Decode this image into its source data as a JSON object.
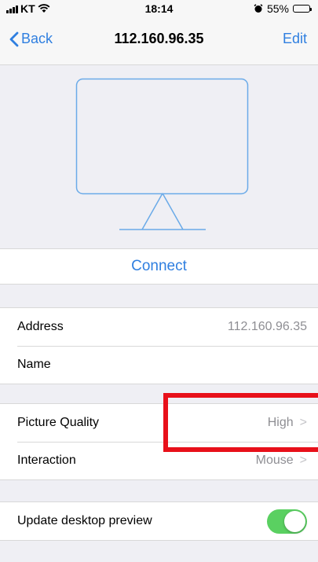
{
  "status_bar": {
    "carrier": "KT",
    "time": "18:14",
    "battery_percent": "55%",
    "battery_level": 0.55
  },
  "nav": {
    "back_label": "Back",
    "title": "112.160.96.35",
    "edit_label": "Edit"
  },
  "connect_label": "Connect",
  "details": {
    "address_label": "Address",
    "address_value": "112.160.96.35",
    "name_label": "Name"
  },
  "settings": {
    "quality_label": "Picture Quality",
    "quality_value": "High",
    "interaction_label": "Interaction",
    "interaction_value": "Mouse"
  },
  "preview_toggle": {
    "label": "Update desktop preview",
    "on": true
  },
  "colors": {
    "accent": "#2f7fe0",
    "toggle_on": "#5ad061",
    "highlight": "#e8101a"
  }
}
